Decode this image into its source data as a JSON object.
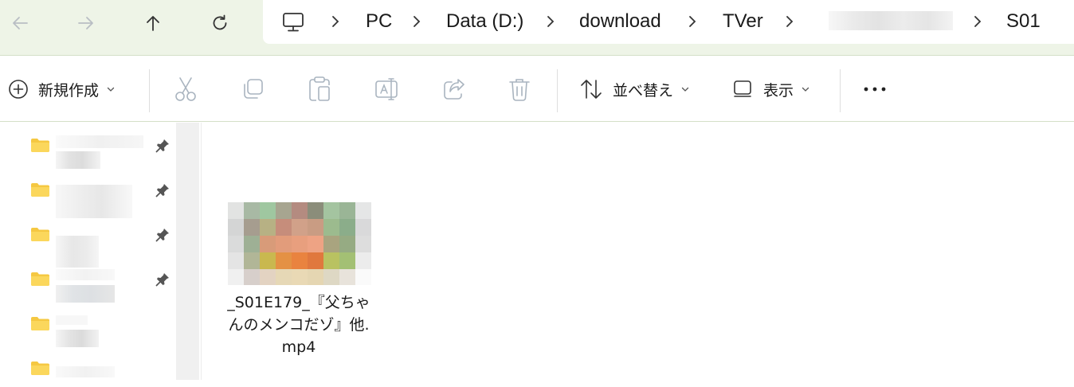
{
  "nav": {
    "back_icon": "arrow-left-icon",
    "forward_icon": "arrow-right-icon",
    "up_icon": "arrow-up-icon",
    "refresh_icon": "refresh-icon"
  },
  "address": {
    "root_icon": "monitor-icon",
    "crumbs": [
      "PC",
      "Data (D:)",
      "download",
      "TVer",
      "S01"
    ]
  },
  "toolbar": {
    "new_label": "新規作成",
    "sort_label": "並べ替え",
    "view_label": "表示",
    "more_icon": "more-icon",
    "icons": [
      "cut-icon",
      "copy-icon",
      "paste-icon",
      "rename-icon",
      "share-icon",
      "delete-icon"
    ]
  },
  "colors": {
    "nav_bg": "#eef4e7",
    "folder_yellow": "#f5c842",
    "icon_disabled": "#a9b4bf",
    "icon_active": "#1a1a1a"
  },
  "files": [
    {
      "name": "_S01E179_『父ちゃ\nんのメンコだゾ』他.\nmp4",
      "type": "video"
    }
  ]
}
